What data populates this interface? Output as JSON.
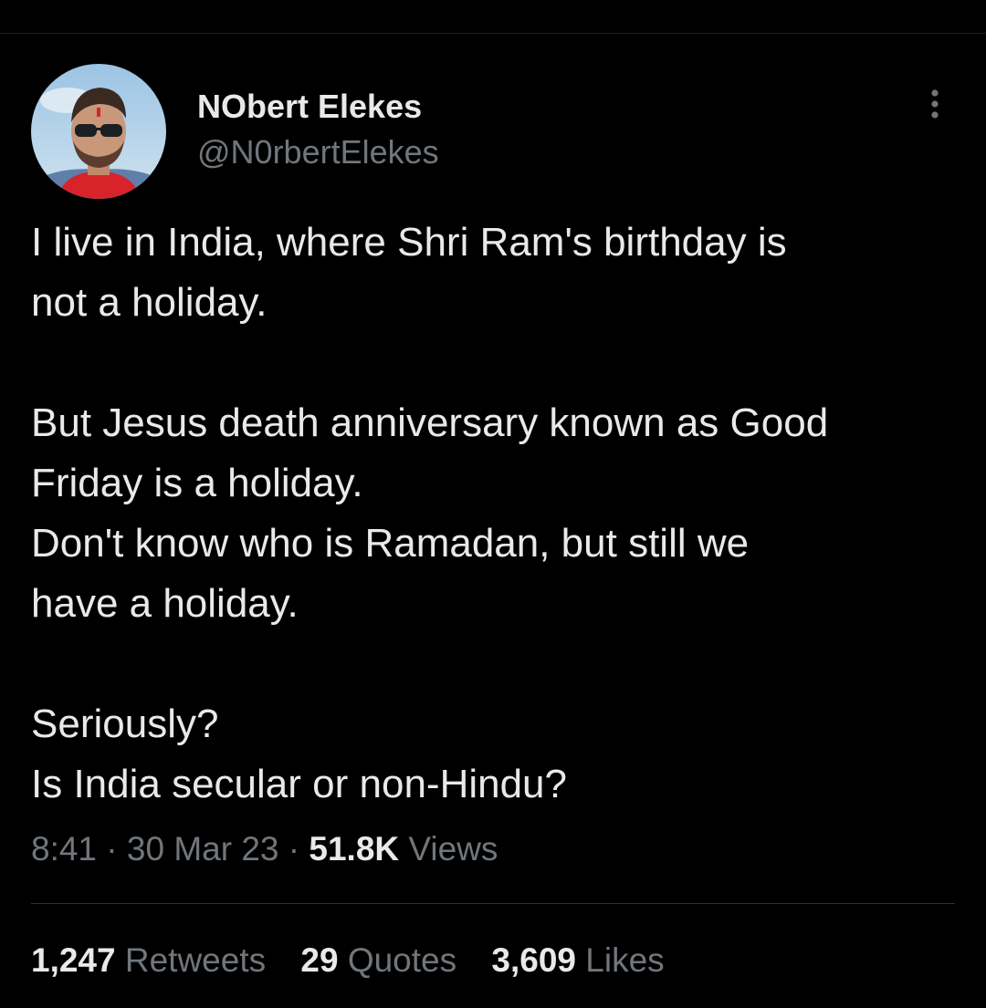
{
  "tweet": {
    "author": {
      "name": "NObert Elekes",
      "handle": "@N0rbertElekes"
    },
    "more_icon": "more-vertical-icon",
    "text": "I live in India, where Shri Ram's birthday is\nnot a holiday.\n\nBut Jesus death anniversary known as Good\nFriday is a holiday.\nDon't know who is Ramadan, but still we\nhave a holiday.\n\nSeriously?\nIs India secular or non-Hindu?",
    "time": "8:41",
    "sep": "·",
    "date": "30 Mar 23",
    "views_count": "51.8K",
    "views_label": "Views",
    "stats": {
      "retweets_count": "1,247",
      "retweets_label": "Retweets",
      "quotes_count": "29",
      "quotes_label": "Quotes",
      "likes_count": "3,609",
      "likes_label": "Likes"
    }
  },
  "colors": {
    "background": "#000000",
    "primary_text": "#e7e9ea",
    "secondary_text": "#71767b",
    "divider": "#2f3336"
  }
}
